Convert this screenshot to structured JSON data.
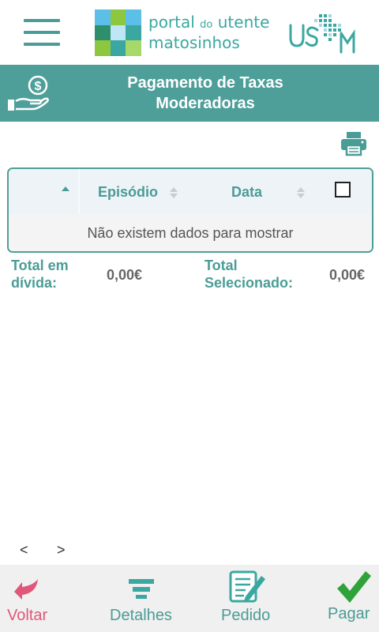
{
  "header": {
    "menu_icon": "hamburger-menu-icon",
    "logo_line1_a": "portal",
    "logo_line1_b": "do",
    "logo_line1_c": "utente",
    "logo_line2": "matosinhos",
    "logo_mosaic_colors": [
      "#5bbfe8",
      "#8dc63f",
      "#5bbfe8",
      "#2e8f6c",
      "#bfe6f6",
      "#3aa8a0",
      "#8dc63f",
      "#3aa8a0",
      "#a6d96a"
    ],
    "usm_logo_color": "#3aa8a0"
  },
  "title_bar": {
    "title_line1": "Pagamento de Taxas",
    "title_line2": "Moderadoras",
    "icon": "hand-money-icon",
    "color": "#4e9f99"
  },
  "toolbar": {
    "print_icon": "printer-icon"
  },
  "table": {
    "columns": [
      "",
      "Episódio",
      "Data",
      ""
    ],
    "sorted_column_icon": "sort-ascending-icon",
    "empty_message": "Não existem dados para mostrar"
  },
  "totals": {
    "debt_label_line1": "Total em",
    "debt_label_line2": "dívida:",
    "debt_value": "0,00€",
    "selected_label_line1": "Total",
    "selected_label_line2": "Selecionado:",
    "selected_value": "0,00€"
  },
  "pager": {
    "prev": "<",
    "next": ">"
  },
  "bottom_nav": {
    "back": {
      "label": "Voltar",
      "icon": "back-arrow-icon",
      "color": "#e0577a"
    },
    "details": {
      "label": "Detalhes",
      "icon": "details-list-icon",
      "color": "#3aa8a0"
    },
    "request": {
      "label": "Pedido",
      "icon": "edit-document-icon",
      "color": "#3aa8a0"
    },
    "pay": {
      "label": "Pagar",
      "icon": "checkmark-icon",
      "color": "#2fa33a"
    }
  },
  "colors": {
    "accent": "#4e9f99",
    "text_accent": "#4a9c96"
  }
}
